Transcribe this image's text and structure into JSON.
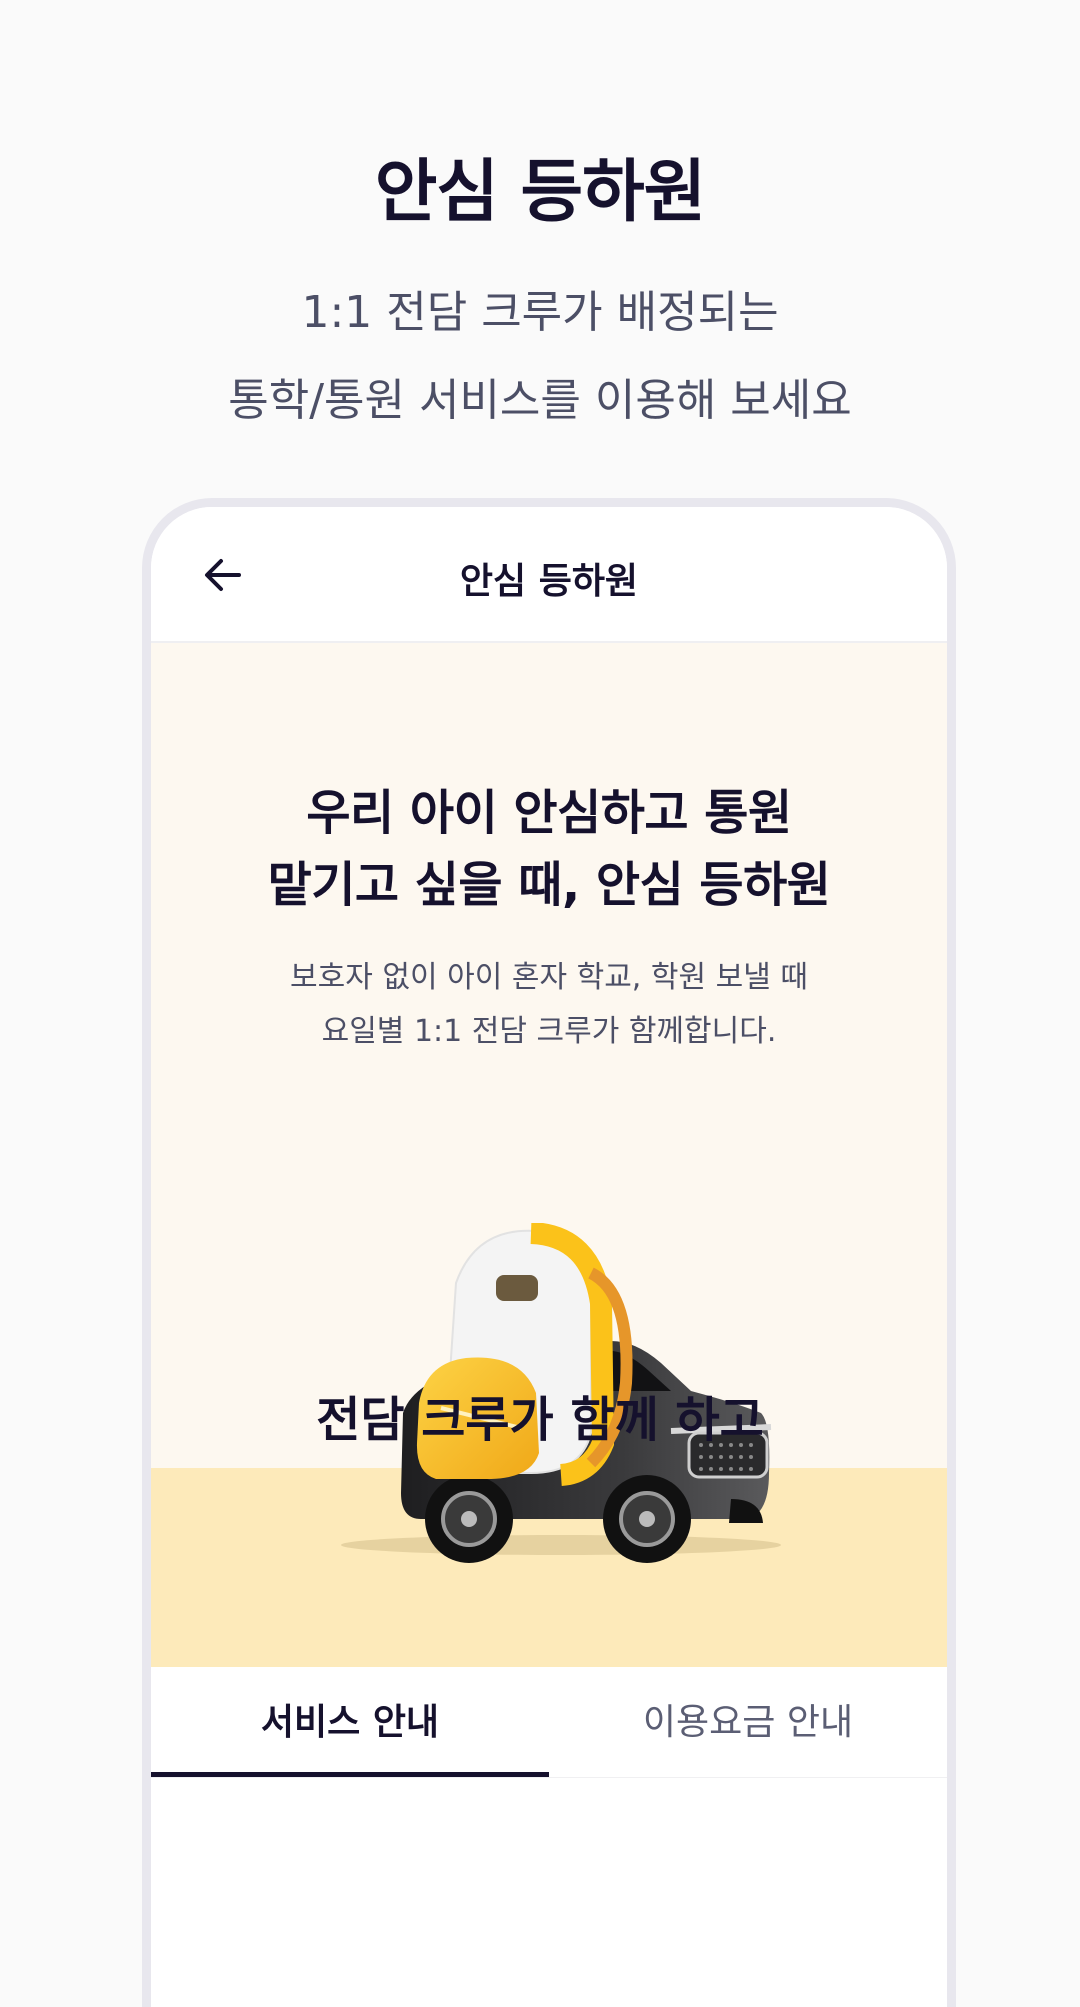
{
  "promo": {
    "title": "안심 등하원",
    "subtitle_line1": "1:1 전담 크루가 배정되는",
    "subtitle_line2": "통학/통원 서비스를 이용해 보세요"
  },
  "app": {
    "header_title": "안심 등하원",
    "back_icon": "arrow-left-icon"
  },
  "hero": {
    "title_line1": "우리 아이 안심하고 통원",
    "title_line2": "맡기고 싶을 때, 안심 등하원",
    "desc_line1": "보호자 없이 아이 혼자 학교, 학원 보낼 때",
    "desc_line2": "요일별 1:1 전담 크루가 함께합니다.",
    "illustration": "car-with-backpack-illustration"
  },
  "tabs": [
    {
      "label": "서비스 안내",
      "active": true
    },
    {
      "label": "이용요금 안내",
      "active": false
    }
  ],
  "section": {
    "heading": "전담 크루가 함께 하고"
  },
  "colors": {
    "text_dark": "#15112d",
    "text_muted": "#4c4f66",
    "hero_bg": "#fdf8f0",
    "hero_floor": "#fdeaba",
    "backpack_yellow": "#fcc21a"
  }
}
